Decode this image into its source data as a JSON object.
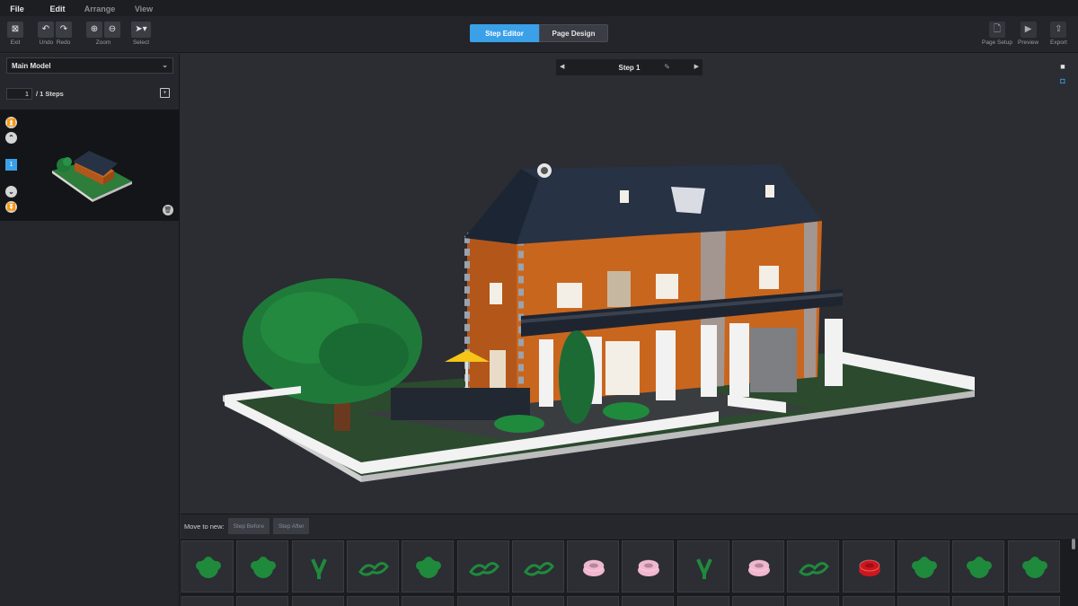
{
  "menu": [
    "File",
    "Edit",
    "Arrange",
    "View"
  ],
  "toolbar": {
    "exit_label": "Exit",
    "undo_label": "Undo",
    "redo_label": "Redo",
    "zoom_label": "Zoom",
    "select_label": "Select",
    "mode_tabs": [
      "Step Editor",
      "Page Design"
    ],
    "active_mode": "Step Editor",
    "page_setup_label": "Page Setup",
    "preview_label": "Preview",
    "export_label": "Export"
  },
  "left_panel": {
    "model_select_value": "Main Model",
    "current_step": "1",
    "steps_total": "/ 1 Steps",
    "step_badge": "1"
  },
  "canvas": {
    "step_title": "Step 1"
  },
  "move_bar": {
    "label": "Move to new:",
    "step_before": "Step Before",
    "step_after": "Step After"
  },
  "parts": [
    {
      "icon": "green-bush-icon",
      "color": "#1f8a3c"
    },
    {
      "icon": "green-bush-icon",
      "color": "#1f8a3c"
    },
    {
      "icon": "green-stem-icon",
      "color": "#1f8a3c"
    },
    {
      "icon": "green-leaves-icon",
      "color": "#1f8a3c"
    },
    {
      "icon": "green-bush-icon",
      "color": "#1f8a3c"
    },
    {
      "icon": "green-leaves-icon",
      "color": "#1f8a3c"
    },
    {
      "icon": "green-leaves-icon",
      "color": "#1f8a3c"
    },
    {
      "icon": "pink-round-plate-icon",
      "color": "#f2b6cf"
    },
    {
      "icon": "pink-round-plate-icon",
      "color": "#f2b6cf"
    },
    {
      "icon": "green-stem-icon",
      "color": "#1f8a3c"
    },
    {
      "icon": "pink-round-plate-icon",
      "color": "#f2b6cf"
    },
    {
      "icon": "green-leaves-icon",
      "color": "#1f8a3c"
    },
    {
      "icon": "red-round-plate-icon",
      "color": "#d0151d"
    },
    {
      "icon": "green-bush-icon",
      "color": "#1f8a3c"
    },
    {
      "icon": "green-bush-icon",
      "color": "#1f8a3c"
    },
    {
      "icon": "green-bush-icon",
      "color": "#1f8a3c"
    }
  ],
  "colors": {
    "accent": "#3aa0e8",
    "brick_orange": "#c9661e",
    "roof": "#2a3447",
    "foliage": "#1f7a3a"
  }
}
